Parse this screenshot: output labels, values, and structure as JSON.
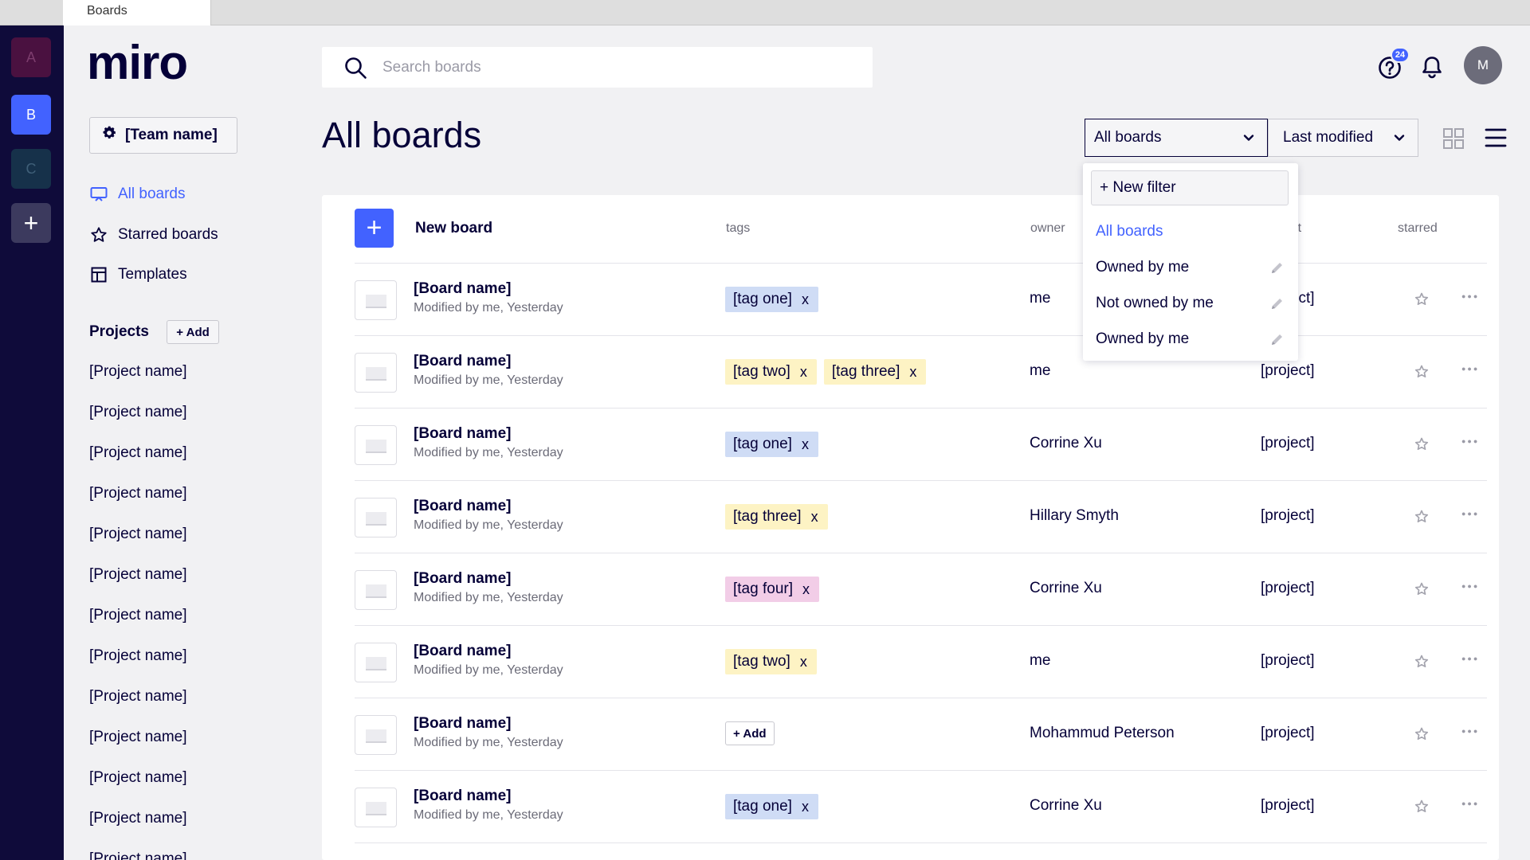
{
  "browser": {
    "tab_title": "Boards"
  },
  "rail": {
    "items": [
      "A",
      "B",
      "C"
    ],
    "add": "+"
  },
  "brand": {
    "logo": "miro"
  },
  "sidebar": {
    "team_name": "[Team name]",
    "nav": [
      {
        "label": "All boards",
        "icon": "board-icon",
        "active": true
      },
      {
        "label": "Starred boards",
        "icon": "star-icon"
      },
      {
        "label": "Templates",
        "icon": "template-icon"
      }
    ],
    "projects_heading": "Projects",
    "projects_add": "+ Add",
    "projects": [
      "[Project name]",
      "[Project name]",
      "[Project name]",
      "[Project name]",
      "[Project name]",
      "[Project name]",
      "[Project name]",
      "[Project name]",
      "[Project name]",
      "[Project name]",
      "[Project name]",
      "[Project name]",
      "[Project name]"
    ]
  },
  "topbar": {
    "search_placeholder": "Search boards",
    "help_badge": "24",
    "avatar_initial": "M"
  },
  "header": {
    "title": "All boards",
    "filter_value": "All boards",
    "sort_value": "Last modified"
  },
  "table": {
    "new_board_label": "New board",
    "columns": {
      "tags": "tags",
      "owner": "owner",
      "project": "project",
      "starred": "starred"
    },
    "add_tag_label": "+ Add",
    "rows": [
      {
        "name": "[Board name]",
        "modified": "Modified by me, Yesterday",
        "tags": [
          {
            "label": "[tag one]",
            "kind": "one"
          }
        ],
        "owner": "me",
        "project": "[project]"
      },
      {
        "name": "[Board name]",
        "modified": "Modified by me, Yesterday",
        "tags": [
          {
            "label": "[tag two]",
            "kind": "two"
          },
          {
            "label": "[tag three]",
            "kind": "three"
          }
        ],
        "owner": "me",
        "project": "[project]"
      },
      {
        "name": "[Board name]",
        "modified": "Modified by me, Yesterday",
        "tags": [
          {
            "label": "[tag one]",
            "kind": "one"
          }
        ],
        "owner": "Corrine Xu",
        "project": "[project]"
      },
      {
        "name": "[Board name]",
        "modified": "Modified by me, Yesterday",
        "tags": [
          {
            "label": "[tag three]",
            "kind": "three"
          }
        ],
        "owner": "Hillary Smyth",
        "project": "[project]"
      },
      {
        "name": "[Board name]",
        "modified": "Modified by me, Yesterday",
        "tags": [
          {
            "label": "[tag four]",
            "kind": "four"
          }
        ],
        "owner": "Corrine Xu",
        "project": "[project]"
      },
      {
        "name": "[Board name]",
        "modified": "Modified by me, Yesterday",
        "tags": [
          {
            "label": "[tag two]",
            "kind": "two"
          }
        ],
        "owner": "me",
        "project": "[project]"
      },
      {
        "name": "[Board name]",
        "modified": "Modified by me, Yesterday",
        "tags": [],
        "owner": "Mohammud Peterson",
        "project": "[project]"
      },
      {
        "name": "[Board name]",
        "modified": "Modified by me, Yesterday",
        "tags": [
          {
            "label": "[tag one]",
            "kind": "one"
          }
        ],
        "owner": "Corrine Xu",
        "project": "[project]"
      }
    ]
  },
  "filter_dropdown": {
    "new_filter": "+ New filter",
    "items": [
      {
        "label": "All boards",
        "active": true,
        "editable": false
      },
      {
        "label": "Owned by me",
        "editable": true
      },
      {
        "label": "Not owned by me",
        "editable": true
      },
      {
        "label": "Owned by me",
        "editable": true
      }
    ]
  },
  "colors": {
    "accent": "#4262ff",
    "ink": "#050038",
    "rail": "#0f0b3a",
    "tag_one": "#cfdcf5",
    "tag_two": "#fdf3c4",
    "tag_four": "#f2cde7"
  }
}
